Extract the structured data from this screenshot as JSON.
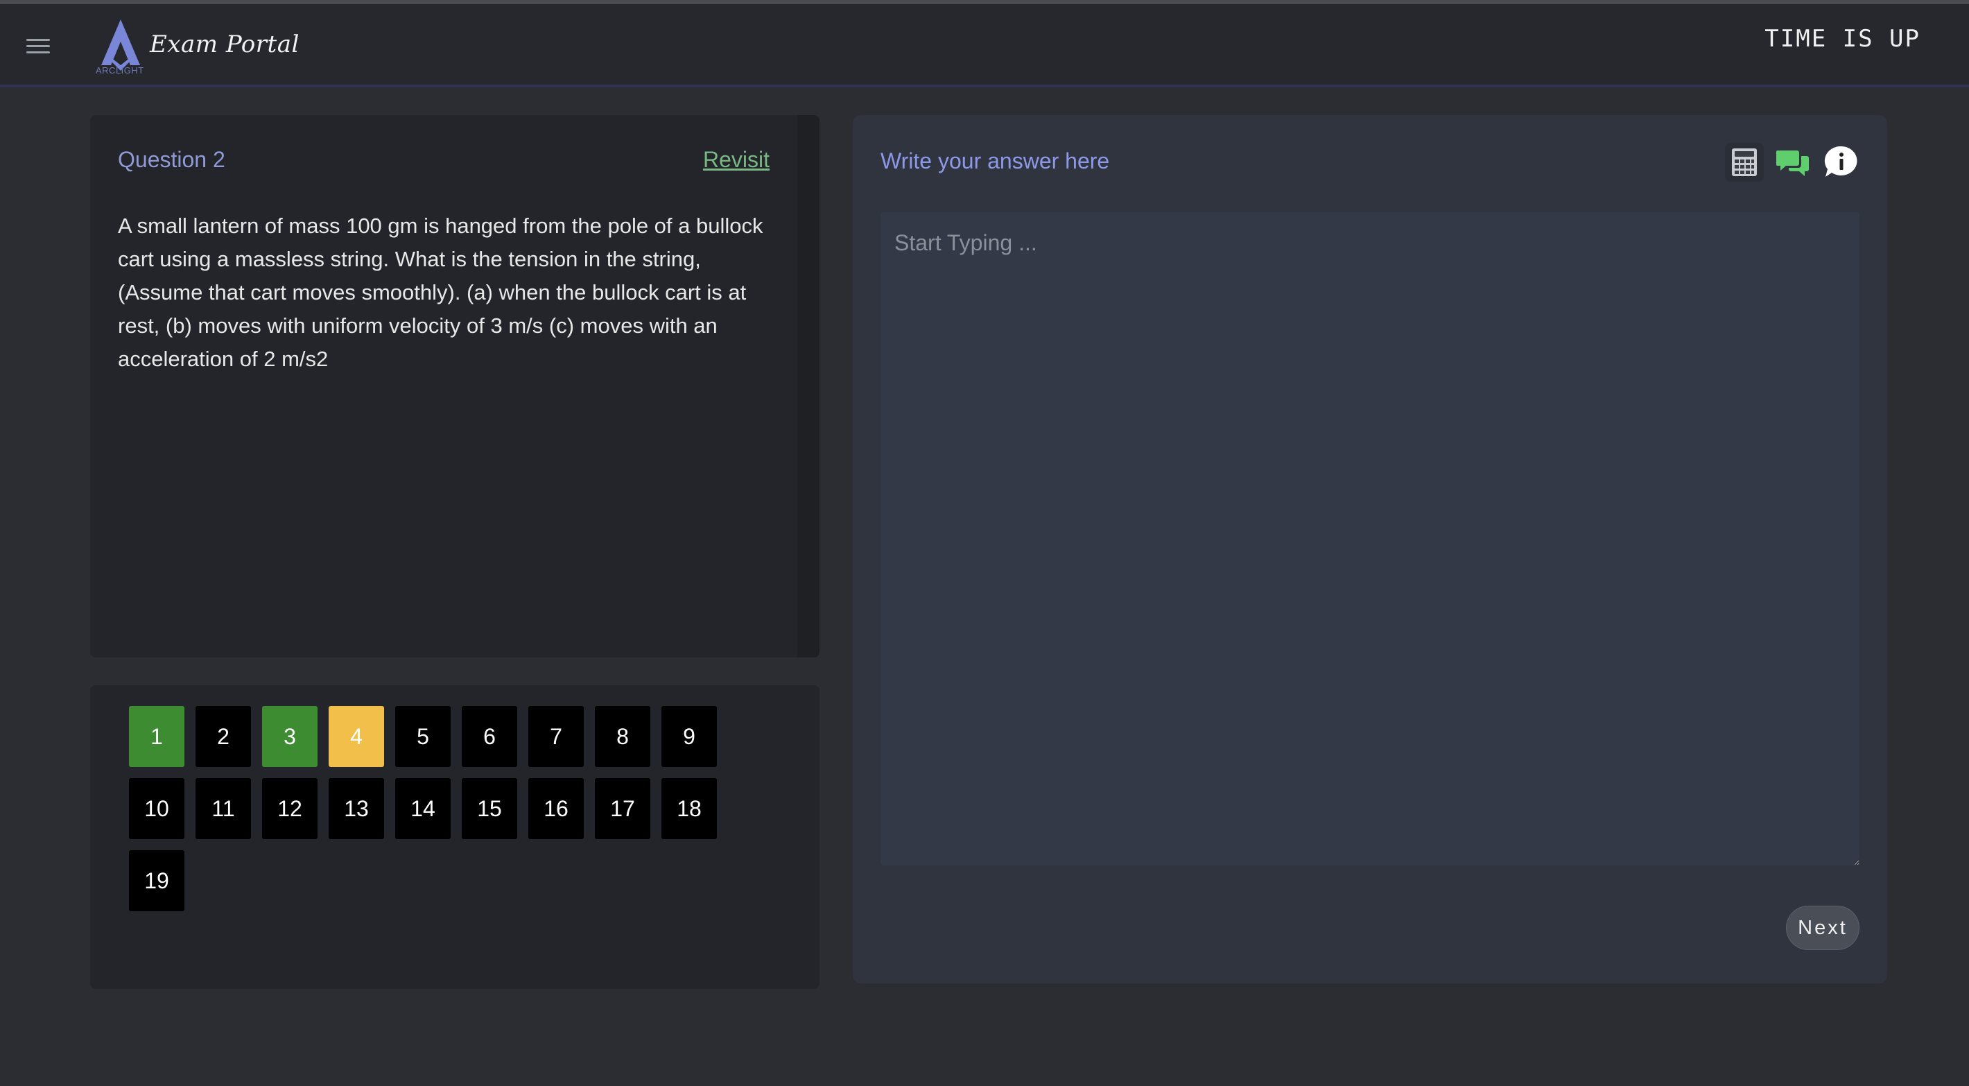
{
  "header": {
    "brand_title": "Exam Portal",
    "brand_sub": "ARCLIGHT",
    "timer": "TIME IS UP"
  },
  "question": {
    "label": "Question 2",
    "revisit": "Revisit",
    "text": "A small lantern of mass 100 gm is hanged from the pole of a bullock cart using a massless string. What is the tension in the string, (Assume that cart moves smoothly). (a) when the bullock cart is at rest, (b) moves with uniform velocity of 3 m/s (c) moves with an acceleration of 2 m/s2"
  },
  "navigator": {
    "items": [
      {
        "num": "1",
        "status": "answered"
      },
      {
        "num": "2",
        "status": "unanswered"
      },
      {
        "num": "3",
        "status": "answered"
      },
      {
        "num": "4",
        "status": "current"
      },
      {
        "num": "5",
        "status": "unanswered"
      },
      {
        "num": "6",
        "status": "unanswered"
      },
      {
        "num": "7",
        "status": "unanswered"
      },
      {
        "num": "8",
        "status": "unanswered"
      },
      {
        "num": "9",
        "status": "unanswered"
      },
      {
        "num": "10",
        "status": "unanswered"
      },
      {
        "num": "11",
        "status": "unanswered"
      },
      {
        "num": "12",
        "status": "unanswered"
      },
      {
        "num": "13",
        "status": "unanswered"
      },
      {
        "num": "14",
        "status": "unanswered"
      },
      {
        "num": "15",
        "status": "unanswered"
      },
      {
        "num": "16",
        "status": "unanswered"
      },
      {
        "num": "17",
        "status": "unanswered"
      },
      {
        "num": "18",
        "status": "unanswered"
      },
      {
        "num": "19",
        "status": "unanswered"
      }
    ],
    "colors": {
      "answered": "#3d8c32",
      "current": "#f2c04a",
      "unanswered": "#000000"
    }
  },
  "answer": {
    "title": "Write your answer here",
    "placeholder": "Start Typing ...",
    "value": "",
    "next_label": "Next",
    "tools": [
      "calculator-icon",
      "chat-icon",
      "info-icon"
    ]
  },
  "colors": {
    "accent": "#8c99e8",
    "revisit": "#79b784",
    "background": "#2b2d33"
  }
}
